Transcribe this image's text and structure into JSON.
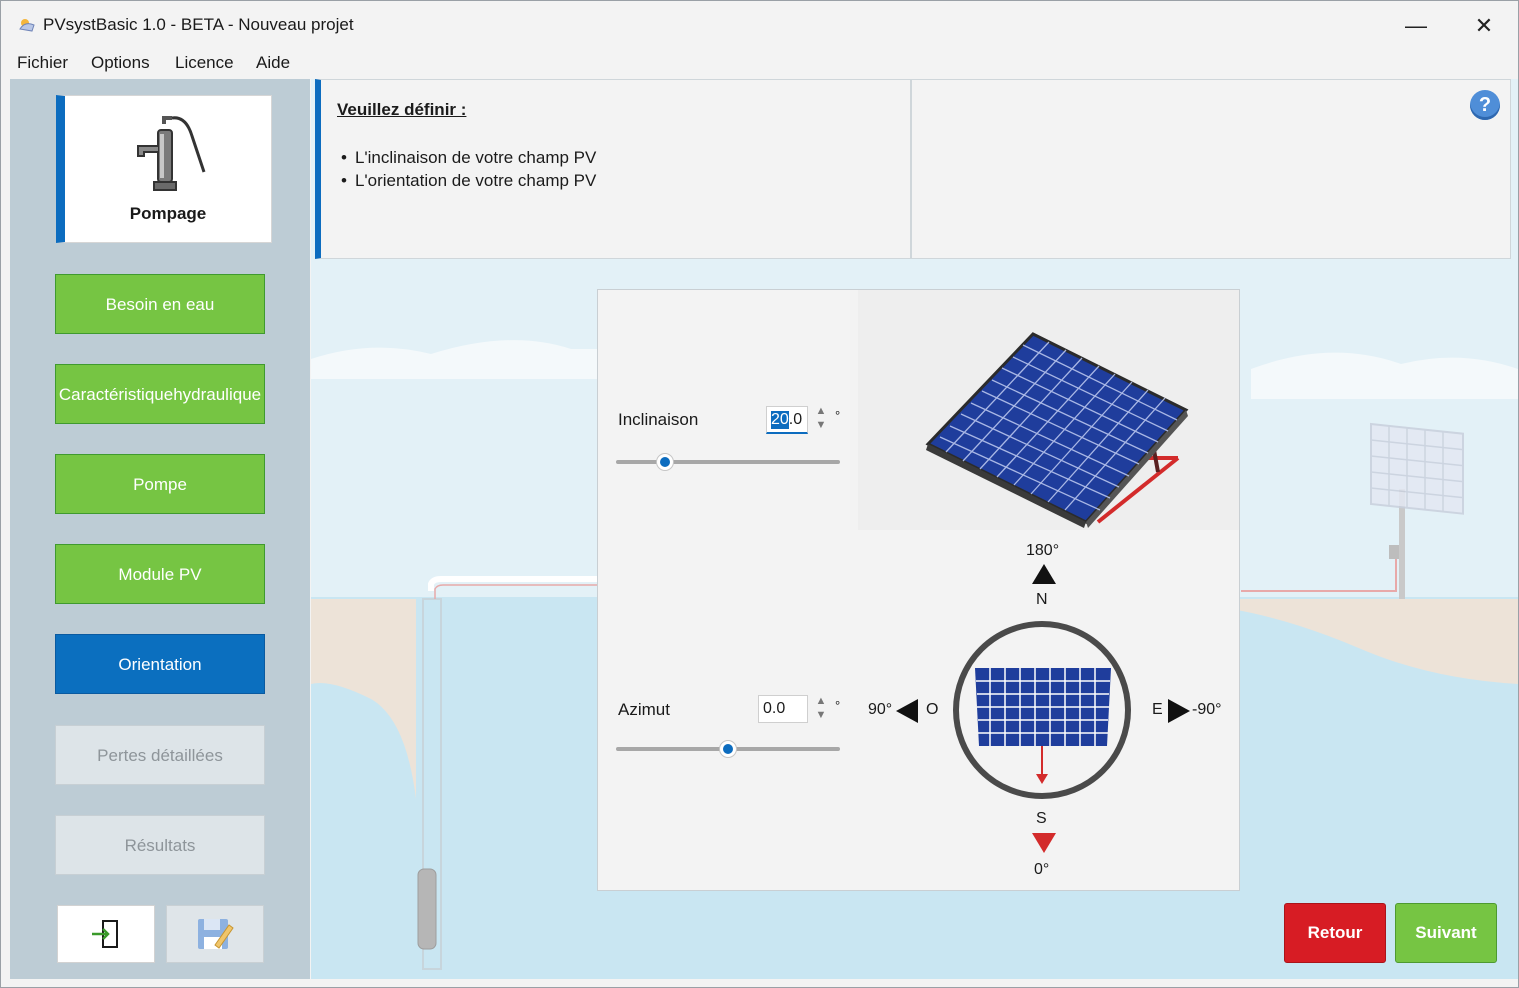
{
  "window": {
    "title": "PVsystBasic 1.0 - BETA - Nouveau projet",
    "minimize_symbol": "—",
    "close_symbol": "✕"
  },
  "menu": {
    "items": [
      "Fichier",
      "Options",
      "Licence",
      "Aide"
    ]
  },
  "sidebar": {
    "step_card_label": "Pompage",
    "steps": [
      {
        "label": "Besoin en eau",
        "state": "done"
      },
      {
        "label": "Caractéristique\nhydraulique",
        "state": "done"
      },
      {
        "label": "Pompe",
        "state": "done"
      },
      {
        "label": "Module PV",
        "state": "done"
      },
      {
        "label": "Orientation",
        "state": "active"
      },
      {
        "label": "Pertes détaillées",
        "state": "disabled"
      },
      {
        "label": "Résultats",
        "state": "disabled"
      }
    ],
    "icons": [
      "exit-icon",
      "save-icon"
    ]
  },
  "info": {
    "title": "Veuillez définir :",
    "items": [
      "L'inclinaison de votre champ PV",
      "L'orientation de votre champ PV"
    ],
    "help_symbol": "?"
  },
  "orientation": {
    "inclinaison_label": "Inclinaison",
    "inclinaison_value_selected": "20",
    "inclinaison_value_rest": ".0",
    "inclinaison_slider_fraction": 0.22,
    "azimut_label": "Azimut",
    "azimut_value": "0.0",
    "azimut_slider_fraction": 0.5,
    "degree_unit": "°",
    "compass": {
      "north_angle": "180°",
      "north_letter": "N",
      "west_angle": "90°",
      "west_letter": "O",
      "east_letter": "E",
      "east_angle": "-90°",
      "south_letter": "S",
      "south_angle": "0°"
    }
  },
  "actions": {
    "back": "Retour",
    "next": "Suivant"
  },
  "colors": {
    "accent": "#0c6cbf",
    "done": "#76c543",
    "back": "#d71c24",
    "panel_blue": "#1f3d9c"
  }
}
